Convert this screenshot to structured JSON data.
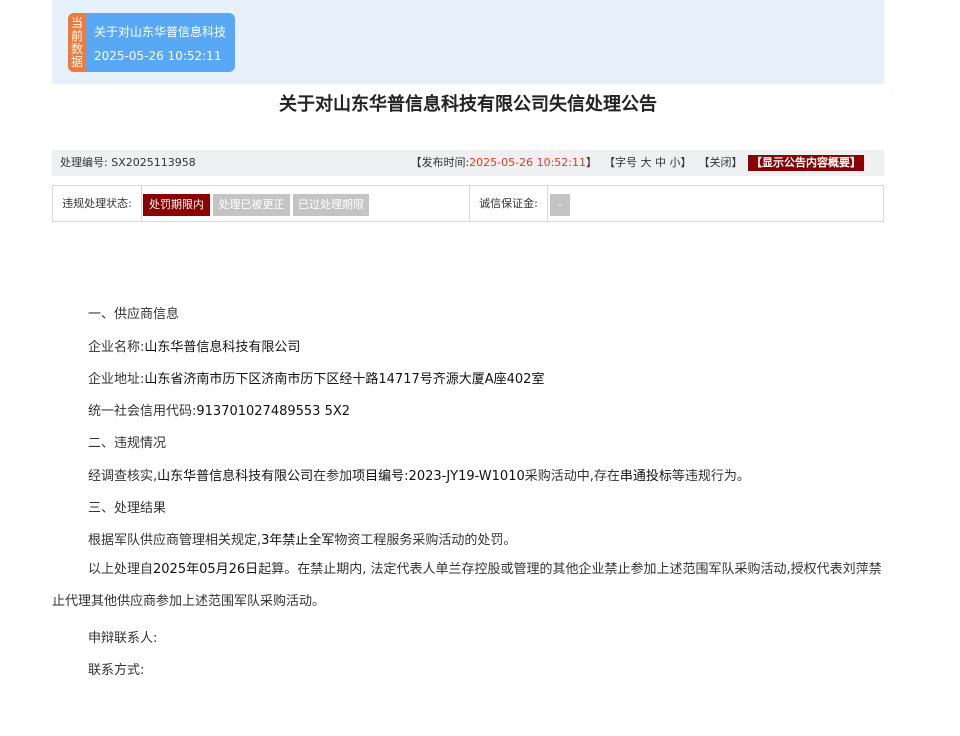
{
  "banner": {
    "tag_chars": [
      "当",
      "前",
      "数",
      "据"
    ],
    "card_title": "关于对山东华普信息科技",
    "card_time": "2025-05-26 10:52:11"
  },
  "title": "关于对山东华普信息科技有限公司失信处理公告",
  "info_bar": {
    "code_label": "处理编号:",
    "code_value": "SX2025113958",
    "publish_open": "【发布时间:",
    "publish_time": "2025-05-26 10:52:11",
    "publish_close": "】",
    "font_open": "【字号",
    "font_large": "大",
    "font_medium": "中",
    "font_small": "小",
    "font_close": "】",
    "close_link": "【关闭】",
    "summary_button": "【显示公告内容概要】"
  },
  "status": {
    "label": "违规处理状态:",
    "btn_active": "处罚期限内",
    "btn_corrected": "处理已被更正",
    "btn_expired": "已过处理期限",
    "deposit_label": "诚信保证金:",
    "deposit_value": "-"
  },
  "content": {
    "section1": "一、供应商信息",
    "company_label": "企业名称:",
    "company_value": "山东华普信息科技有限公司",
    "address_label": "企业地址:",
    "address_value": "山东省济南市历下区济南市历下区经十路14717号齐源大厦A座402室",
    "credit_label": "统一社会信用代码:",
    "credit_value": "913701027489553 5X2",
    "section2": "二、违规情况",
    "violation_prefix": "经调查核实,",
    "violation_company": "山东华普信息科技有限公司",
    "violation_mid": "在参加",
    "violation_project": "项目编号:2023-JY19-W1010",
    "violation_mid2": "采购活动中,存在",
    "violation_type": "串通投标",
    "violation_suffix": "等违规行为。",
    "section3": "三、处理结果",
    "result_prefix": "根据军队供应商管理相关规定,",
    "result_bold": "3年禁止全军",
    "result_suffix": "物资工程服务采购活动的处罚。",
    "start_prefix": "以上处理自",
    "start_date": "2025年05月26日",
    "start_suffix": "起算。在禁止期内, 法定代表人单兰存控股或管理的其他企业禁止参加上述范围军队采购活动,授权代表刘萍禁止代理其他供应商参加上述范围军队采购活动。",
    "appeal_contact": "申辩联系人:",
    "contact_method": "联系方式:"
  }
}
